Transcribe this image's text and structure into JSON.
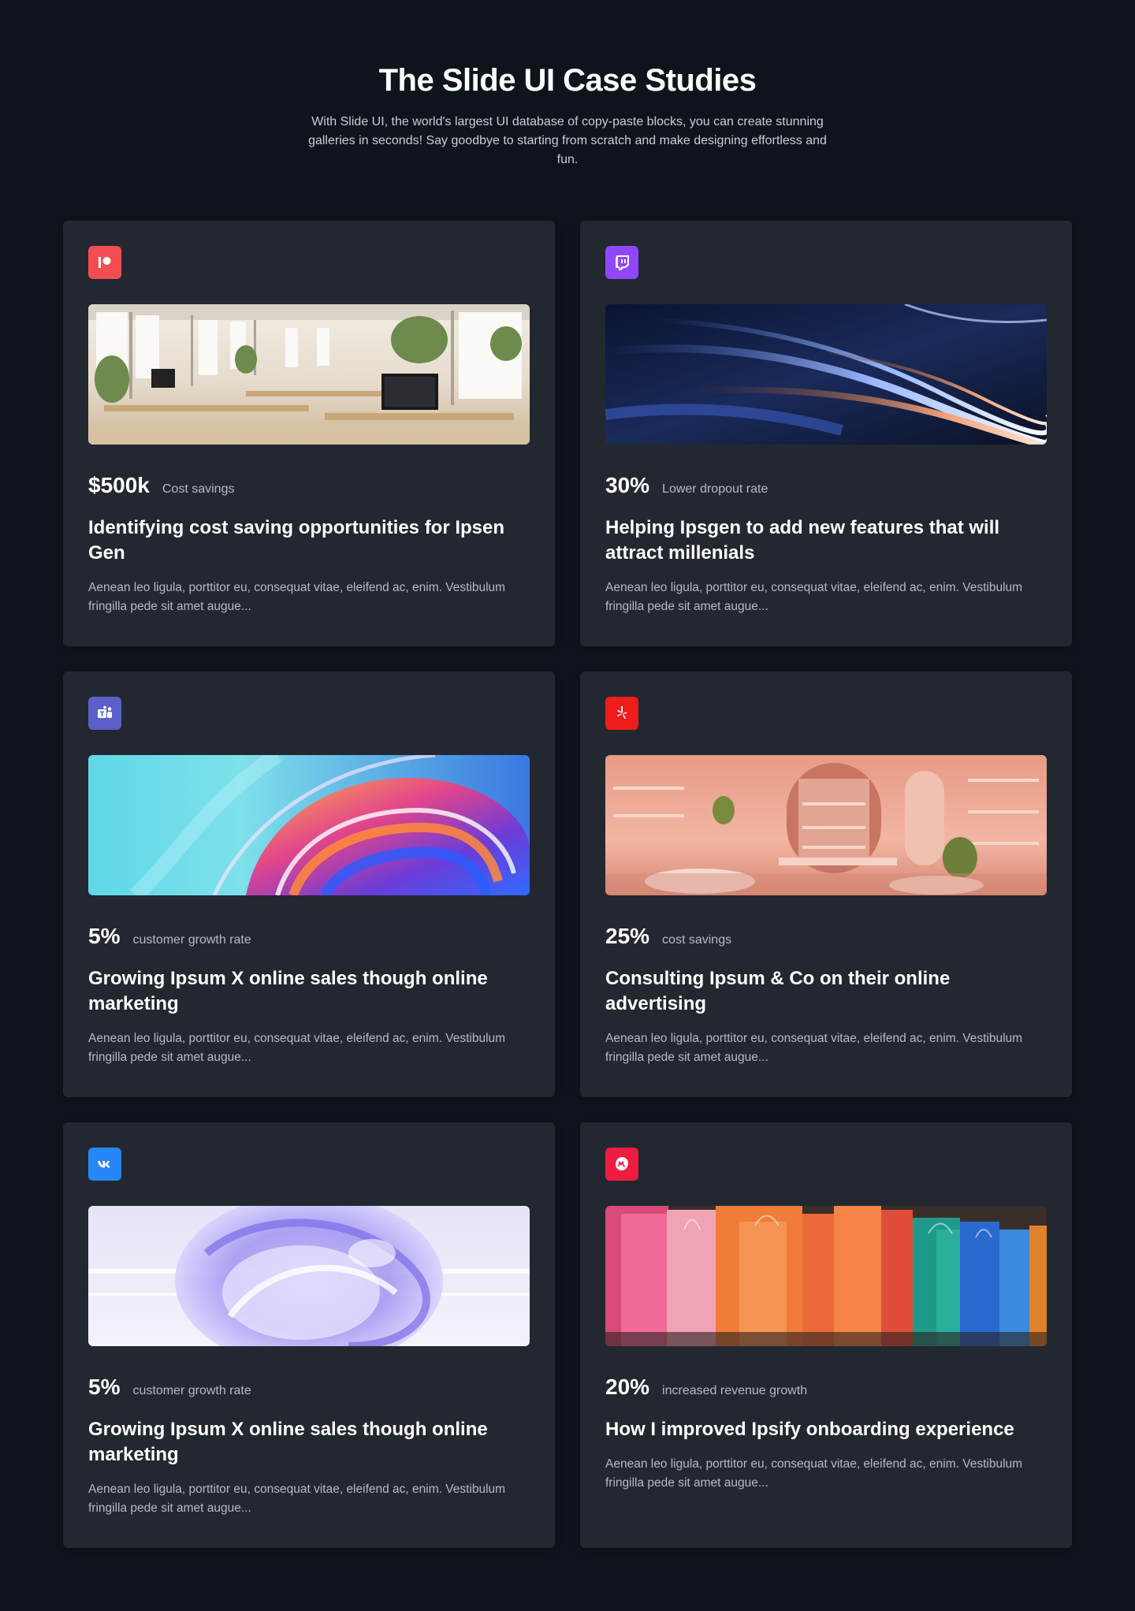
{
  "header": {
    "title": "The Slide UI Case Studies",
    "subtitle": "With Slide UI, the world's largest UI database of copy-paste blocks, you can create stunning galleries in seconds! Say goodbye to starting from scratch and make designing effortless and fun."
  },
  "cards": [
    {
      "icon": "patreon-icon",
      "icon_color": "#f24e52",
      "image": "office-interior-image",
      "stat_value": "$500k",
      "stat_label": "Cost savings",
      "title": "Identifying cost saving opportunities for Ipsen Gen",
      "description": "Aenean leo ligula, porttitor eu, consequat vitae, eleifend ac, enim. Vestibulum fringilla pede sit amet augue..."
    },
    {
      "icon": "twitch-icon",
      "icon_color": "#9146ff",
      "image": "abstract-blue-streaks-image",
      "stat_value": "30%",
      "stat_label": "Lower dropout rate",
      "title": "Helping Ipsgen to add new features that will attract millenials",
      "description": "Aenean leo ligula, porttitor eu, consequat vitae, eleifend ac, enim. Vestibulum fringilla pede sit amet augue..."
    },
    {
      "icon": "teams-icon",
      "icon_color": "#5b5fc7",
      "image": "iridescent-swirl-image",
      "stat_value": "5%",
      "stat_label": "customer growth rate",
      "title": "Growing Ipsum X online sales though online marketing",
      "description": "Aenean leo ligula, porttitor eu, consequat vitae, eleifend ac, enim. Vestibulum fringilla pede sit amet augue..."
    },
    {
      "icon": "yelp-icon",
      "icon_color": "#ef1c1c",
      "image": "pink-store-interior-image",
      "stat_value": "25%",
      "stat_label": "cost savings",
      "title": "Consulting Ipsum & Co on their online advertising",
      "description": "Aenean leo ligula, porttitor eu, consequat vitae, eleifend ac, enim. Vestibulum fringilla pede sit amet augue..."
    },
    {
      "icon": "vk-icon",
      "icon_color": "#2787f5",
      "image": "glass-sphere-image",
      "stat_value": "5%",
      "stat_label": "customer growth rate",
      "title": "Growing Ipsum X online sales though online marketing",
      "description": "Aenean leo ligula, porttitor eu, consequat vitae, eleifend ac, enim. Vestibulum fringilla pede sit amet augue..."
    },
    {
      "icon": "meetup-icon",
      "icon_color": "#ed1c40",
      "image": "shopping-bags-image",
      "stat_value": "20%",
      "stat_label": "increased revenue growth",
      "title": "How I improved Ipsify onboarding experience",
      "description": "Aenean leo ligula, porttitor eu, consequat vitae, eleifend ac, enim. Vestibulum fringilla pede sit amet augue..."
    }
  ]
}
